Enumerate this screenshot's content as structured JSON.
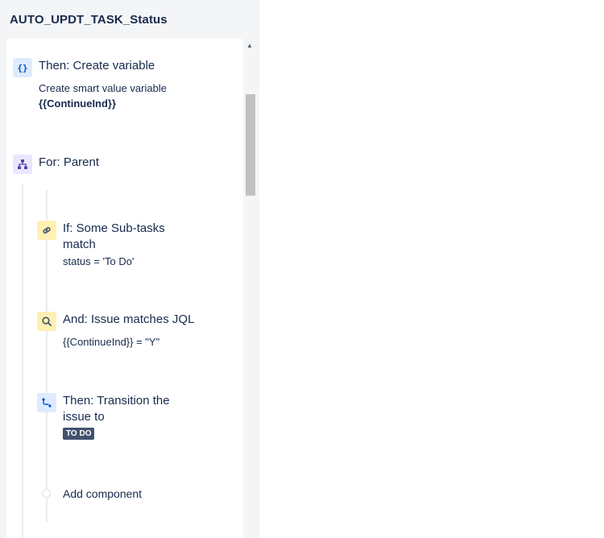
{
  "panel": {
    "title": "AUTO_UPDT_TASK_Status"
  },
  "components": [
    {
      "icon": "braces-icon",
      "icon_glyph": "{}",
      "title": "Then: Create variable",
      "line1": "Create smart value variable",
      "line2": "{{ContinueInd}}"
    },
    {
      "icon": "hierarchy-icon",
      "title": "For: Parent"
    },
    {
      "icon": "link-icon",
      "title_line1": "If: Some Sub-tasks",
      "title_line2": "match",
      "detail": "status = 'To Do'"
    },
    {
      "icon": "search-icon",
      "title": "And: Issue matches JQL",
      "detail": "{{ContinueInd}} = \"Y\""
    },
    {
      "icon": "transition-icon",
      "title_line1": "Then: Transition the",
      "title_line2": "issue to",
      "status_lozenge": "TO DO"
    }
  ],
  "add_component": {
    "label": "Add component"
  },
  "colors": {
    "panel_bg": "#f4f5f7",
    "blue_icon_bg": "#deebff",
    "purple_icon_bg": "#eae6ff",
    "yellow_icon_bg": "#fff0b3",
    "lozenge_bg": "#42526e",
    "text": "#172b4d"
  }
}
